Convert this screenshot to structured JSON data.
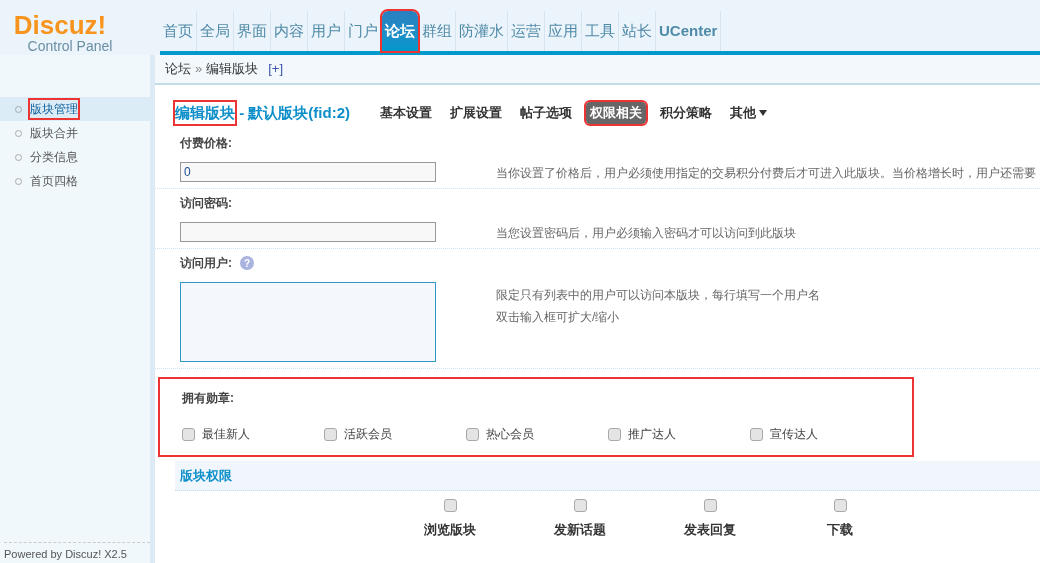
{
  "logo": {
    "name": "Discuz!",
    "subtitle": "Control Panel"
  },
  "nav": [
    {
      "label": "首页",
      "selected": false,
      "annotated": false
    },
    {
      "label": "全局",
      "selected": false,
      "annotated": false
    },
    {
      "label": "界面",
      "selected": false,
      "annotated": false
    },
    {
      "label": "内容",
      "selected": false,
      "annotated": false
    },
    {
      "label": "用户",
      "selected": false,
      "annotated": false
    },
    {
      "label": "门户",
      "selected": false,
      "annotated": false
    },
    {
      "label": "论坛",
      "selected": true,
      "annotated": true
    },
    {
      "label": "群组",
      "selected": false,
      "annotated": false
    },
    {
      "label": "防灌水",
      "selected": false,
      "annotated": false
    },
    {
      "label": "运营",
      "selected": false,
      "annotated": false
    },
    {
      "label": "应用",
      "selected": false,
      "annotated": false
    },
    {
      "label": "工具",
      "selected": false,
      "annotated": false
    },
    {
      "label": "站长",
      "selected": false,
      "annotated": false
    },
    {
      "label": "UCenter",
      "selected": false,
      "annotated": false
    }
  ],
  "breadcrumb": {
    "items": [
      "论坛",
      "编辑版块"
    ],
    "separator": "»",
    "add": "[+]"
  },
  "sidebar": {
    "items": [
      {
        "label": "版块管理",
        "selected": true,
        "annotated": true
      },
      {
        "label": "版块合并",
        "selected": false,
        "annotated": false
      },
      {
        "label": "分类信息",
        "selected": false,
        "annotated": false
      },
      {
        "label": "首页四格",
        "selected": false,
        "annotated": false
      }
    ],
    "footer": "Powered by Discuz! X2.5"
  },
  "heading": {
    "title": "编辑版块",
    "title_annotated": true,
    "subtitle": " - 默认版块(fid:2)"
  },
  "tabs": [
    {
      "label": "基本设置",
      "selected": false,
      "annotated": false,
      "dropdown": false
    },
    {
      "label": "扩展设置",
      "selected": false,
      "annotated": false,
      "dropdown": false
    },
    {
      "label": "帖子选项",
      "selected": false,
      "annotated": false,
      "dropdown": false
    },
    {
      "label": "权限相关",
      "selected": true,
      "annotated": true,
      "dropdown": false
    },
    {
      "label": "积分策略",
      "selected": false,
      "annotated": false,
      "dropdown": false
    },
    {
      "label": "其他",
      "selected": false,
      "annotated": false,
      "dropdown": true
    }
  ],
  "fields": [
    {
      "kind": "input",
      "label": "付费价格:",
      "value": "0",
      "help": [
        "当你设置了价格后，用户必须使用指定的交易积分付费后才可进入此版块。当价格增长时，用户还需要"
      ]
    },
    {
      "kind": "input",
      "label": "访问密码:",
      "help": [
        "当您设置密码后，用户必须输入密码才可以访问到此版块"
      ]
    },
    {
      "kind": "textarea",
      "label": "访问用户:",
      "help_icon": "?",
      "help": [
        "限定只有列表中的用户可以访问本版块，每行填写一个用户名",
        "双击输入框可扩大/缩小"
      ]
    }
  ],
  "medals": {
    "label": "拥有勋章:",
    "annotated": true,
    "items": [
      {
        "label": "最佳新人",
        "checked": false
      },
      {
        "label": "活跃会员",
        "checked": false
      },
      {
        "label": "热心会员",
        "checked": false
      },
      {
        "label": "推广达人",
        "checked": false
      },
      {
        "label": "宣传达人",
        "checked": false
      }
    ]
  },
  "permissions": {
    "title": "版块权限",
    "columns": [
      {
        "label": "浏览版块",
        "checked": false
      },
      {
        "label": "发新话题",
        "checked": false
      },
      {
        "label": "发表回复",
        "checked": false
      },
      {
        "label": "下载",
        "checked": false
      }
    ]
  }
}
